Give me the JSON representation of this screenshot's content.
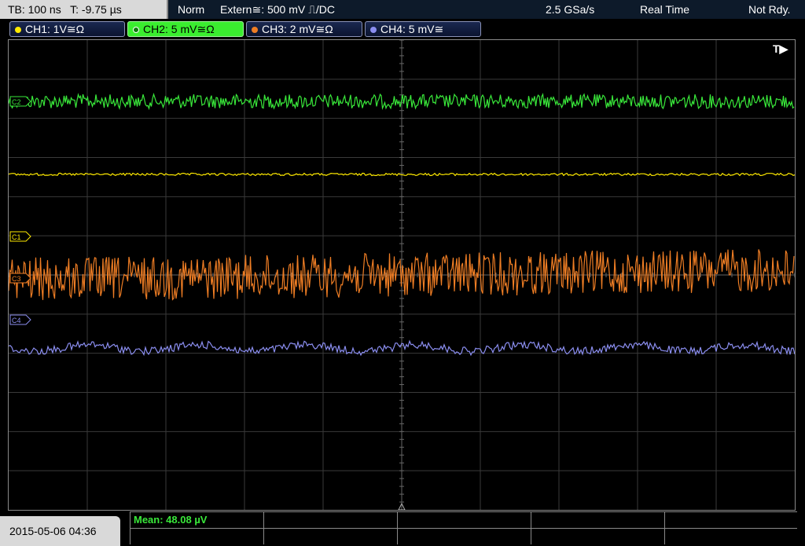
{
  "status_bar": {
    "timebase": "TB: 100 ns",
    "trigger_time": "T: -9.75 µs",
    "trigger_mode": "Norm",
    "trigger_source": "Extern≅: 500 mV ⎍/DC",
    "sample_rate": "2.5 GSa/s",
    "acq_mode": "Real Time",
    "acq_state": "Not Rdy."
  },
  "channels": [
    {
      "label": "CH1: 1V≅Ω",
      "color": "#ffea00",
      "marker": "C1"
    },
    {
      "label": "CH2: 5 mV≅Ω",
      "color": "#39e83a",
      "marker": "C2"
    },
    {
      "label": "CH3: 2 mV≅Ω",
      "color": "#ee7d24",
      "marker": "C3"
    },
    {
      "label": "CH4: 5 mV≅",
      "color": "#8b8ef0",
      "marker": "C4"
    }
  ],
  "active_channel": "CH2",
  "trigger_marker": "T▶",
  "timestamp": "2015-05-06 04:36",
  "measurement": {
    "label": "Mean: 48.08 µV"
  },
  "colors": {
    "grid": "#3a3a3a",
    "grid_center": "#666666",
    "frame": "#8a8a8a"
  }
}
